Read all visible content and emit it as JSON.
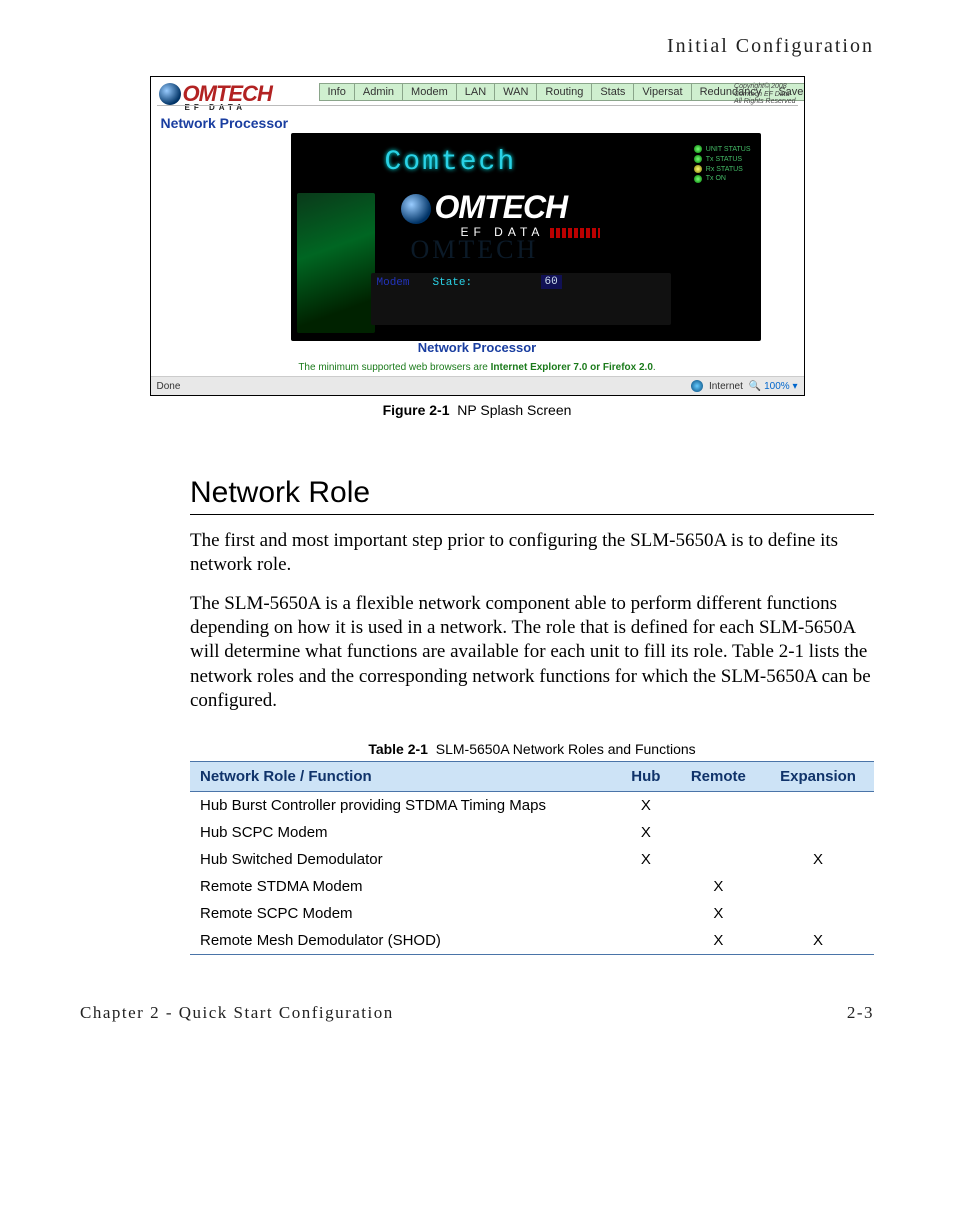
{
  "running_head": "Initial Configuration",
  "screenshot": {
    "brand": "OMTECH",
    "brand_sub": "EF DATA",
    "nav_tabs": [
      "Info",
      "Admin",
      "Modem",
      "LAN",
      "WAN",
      "Routing",
      "Stats",
      "Vipersat",
      "Redundancy",
      "Save"
    ],
    "copyright": [
      "Copyright© 2008",
      "Comtech EF Data",
      "All Rights Reserved"
    ],
    "section_title": "Network Processor",
    "hero_lcd": "Comtech",
    "hero_logo": "OMTECH",
    "hero_ef": "EF DATA",
    "hero_ghost": "OMTECH",
    "mini_modem": "Modem",
    "mini_state": "State:",
    "mini_num": "60",
    "led_labels": [
      "UNIT STATUS",
      "Tx STATUS",
      "Rx STATUS",
      "Tx ON"
    ],
    "np_sub": "Network Processor",
    "browser_note_pre": "The minimum supported web browsers are ",
    "browser_note_bold": "Internet Explorer 7.0 or Firefox 2.0",
    "browser_note_post": ".",
    "status_left": "Done",
    "status_internet": "Internet",
    "status_zoom": "100%"
  },
  "figure": {
    "label": "Figure 2-1",
    "caption": "NP Splash Screen"
  },
  "section_heading": "Network Role",
  "paragraph1": "The first and most important step prior to configuring the SLM-5650A is to define its network role.",
  "paragraph2": "The SLM-5650A is a flexible network component able to perform different functions depending on how it is used in a network. The role that is defined for each SLM-5650A will determine what functions are available for each unit to fill its role. Table 2-1 lists the network roles and the corresponding network functions for which the SLM-5650A can be configured.",
  "table": {
    "label": "Table 2-1",
    "caption": "SLM-5650A Network Roles and Functions",
    "headers": [
      "Network Role / Function",
      "Hub",
      "Remote",
      "Expansion"
    ],
    "rows": [
      {
        "fn": "Hub Burst Controller providing STDMA Timing Maps",
        "hub": "X",
        "remote": "",
        "expansion": ""
      },
      {
        "fn": "Hub SCPC Modem",
        "hub": "X",
        "remote": "",
        "expansion": ""
      },
      {
        "fn": "Hub Switched Demodulator",
        "hub": "X",
        "remote": "",
        "expansion": "X"
      },
      {
        "fn": "Remote STDMA Modem",
        "hub": "",
        "remote": "X",
        "expansion": ""
      },
      {
        "fn": "Remote SCPC Modem",
        "hub": "",
        "remote": "X",
        "expansion": ""
      },
      {
        "fn": "Remote Mesh Demodulator (SHOD)",
        "hub": "",
        "remote": "X",
        "expansion": "X"
      }
    ]
  },
  "footer": {
    "left": "Chapter 2 - Quick Start Configuration",
    "right": "2-3"
  }
}
